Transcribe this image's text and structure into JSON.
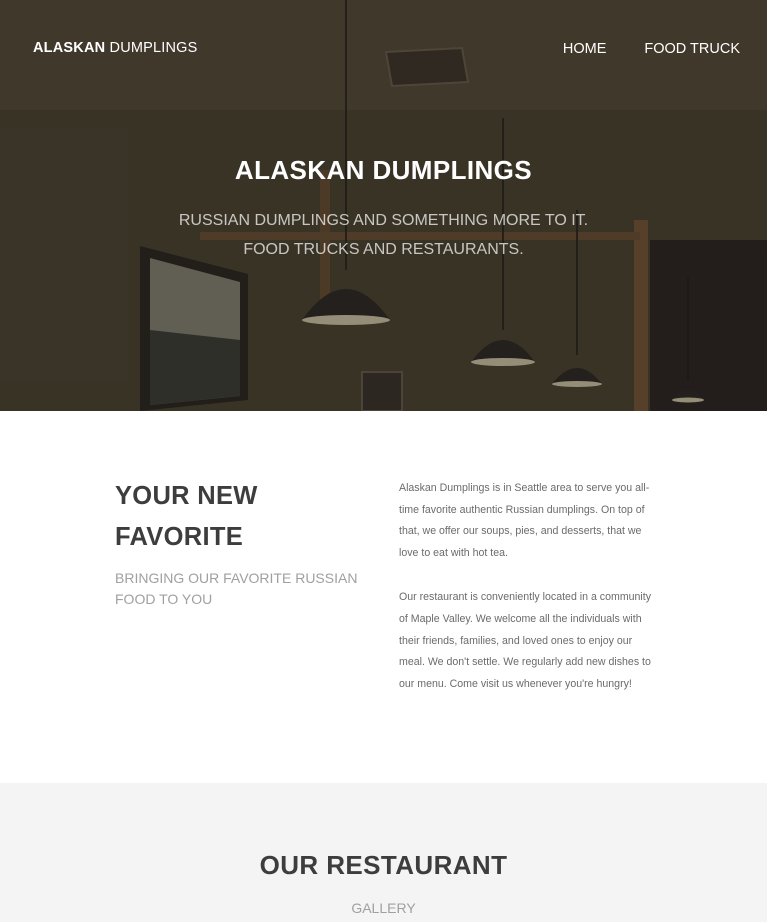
{
  "nav": {
    "brand_bold": "ALASKAN",
    "brand_rest": " DUMPLINGS",
    "links": [
      "HOME",
      "FOOD TRUCK"
    ]
  },
  "hero": {
    "title": "ALASKAN DUMPLINGS",
    "subtitle_line1": "RUSSIAN DUMPLINGS AND SOMETHING MORE TO IT.",
    "subtitle_line2": "FOOD TRUCKS AND RESTAURANTS."
  },
  "about": {
    "title": "YOUR NEW FAVORITE",
    "subtitle": "BRINGING OUR FAVORITE RUSSIAN FOOD TO YOU",
    "paragraphs": [
      "Alaskan Dumplings is in Seattle area to serve you all-time favorite authentic Russian dumplings. On top of that, we offer our soups, pies, and desserts, that we love to eat with hot tea.",
      "Our restaurant is conveniently located in a community of Maple Valley. We welcome all the individuals with their friends, families, and loved ones to enjoy our meal. We don't settle. We regularly add new dishes to our menu. Come visit us whenever you're hungry!"
    ]
  },
  "gallery": {
    "title": "OUR RESTAURANT",
    "subtitle": "GALLERY"
  }
}
